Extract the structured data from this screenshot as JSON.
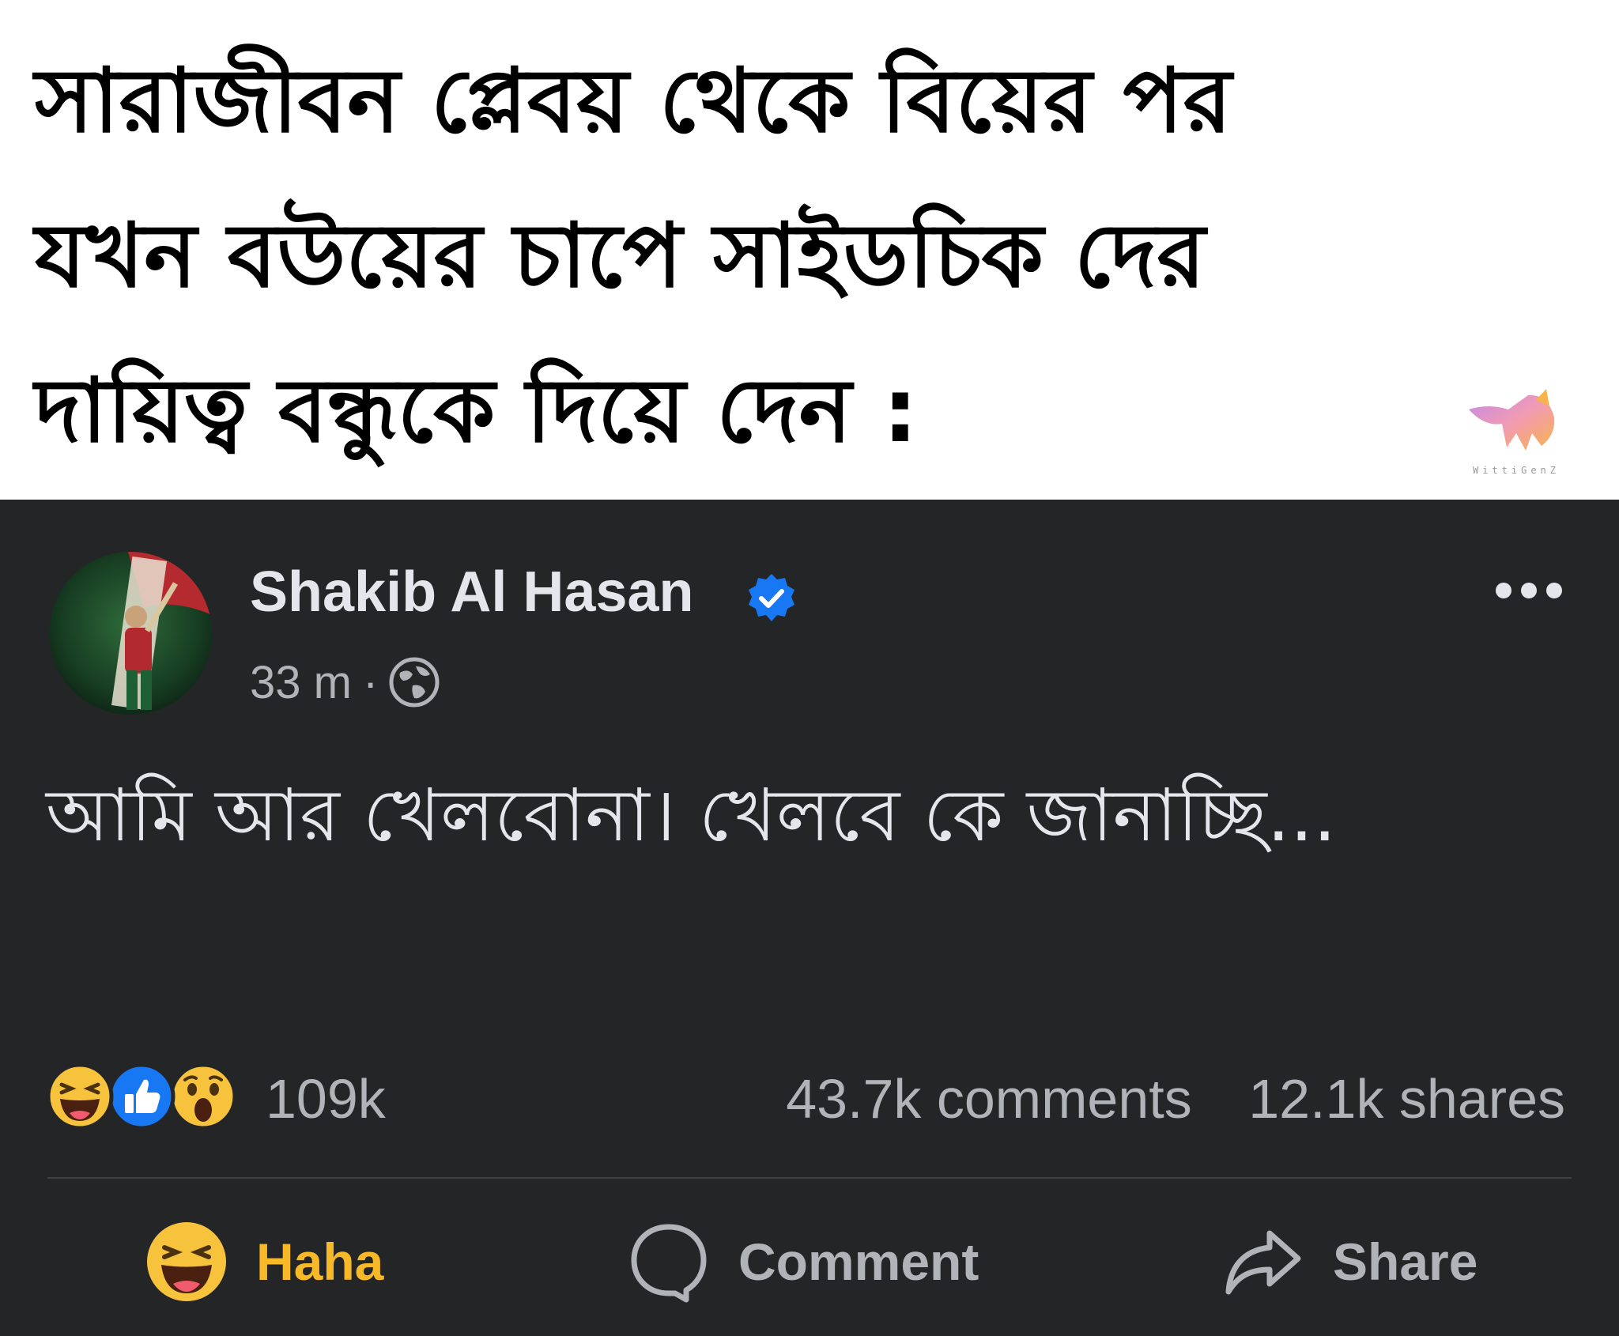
{
  "meme": {
    "caption": "সারাজীবন প্লেবয় থেকে বিয়ের পর\nযখন বউয়ের চাপে সাইডচিক দের\nদায়িত্ব বন্ধুকে দিয়ে দেন :",
    "watermark": "WittiGenZ"
  },
  "post": {
    "author_name": "Shakib Al Hasan",
    "verified": true,
    "timestamp": "33 m",
    "separator": "·",
    "privacy_icon": "globe-icon",
    "text": "আমি আর খেলবোনা। খেলবে কে জানাচ্ছি..."
  },
  "reactions": {
    "emojis": [
      "haha-emoji",
      "like-emoji",
      "wow-emoji"
    ],
    "count": "109k",
    "comments": "43.7k comments",
    "shares": "12.1k shares"
  },
  "actions": {
    "haha_label": "Haha",
    "comment_label": "Comment",
    "share_label": "Share"
  },
  "colors": {
    "card_background": "#242526",
    "primary_text": "#e4e6eb",
    "secondary_text": "#b0b3b8",
    "verified_blue": "#1877f2",
    "haha_yellow": "#f7b928"
  }
}
